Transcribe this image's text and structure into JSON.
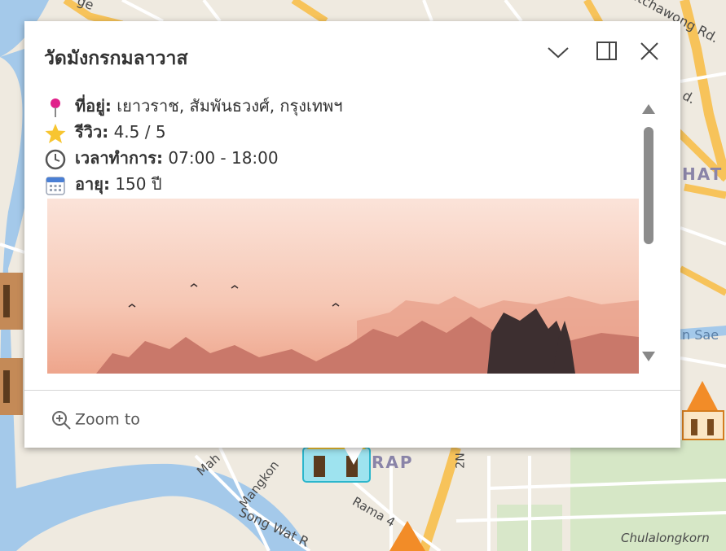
{
  "map": {
    "street_labels": [
      "ge",
      "Ratchawong Rd.",
      "d.",
      "HAT",
      "n Sae",
      "Mah",
      "Mangkon",
      "Song Wat R",
      "Rama 4",
      "RAP",
      "Chulalongkorn",
      "2N"
    ]
  },
  "popup": {
    "title": "วัดมังกรกมลาวาส",
    "fields": [
      {
        "icon": "pin-icon",
        "label": "ที่อยู่:",
        "value": "เยาวราช, สัมพันธวงศ์, กรุงเทพฯ"
      },
      {
        "icon": "star-icon",
        "label": "รีวิว:",
        "value": "4.5 / 5"
      },
      {
        "icon": "clock-icon",
        "label": "เวลาทำการ:",
        "value": "07:00 - 18:00"
      },
      {
        "icon": "calendar-icon",
        "label": "อายุ:",
        "value": "150 ปี"
      }
    ],
    "footer": {
      "zoom_label": "Zoom to"
    }
  },
  "colors": {
    "road_major": "#f7c35a",
    "water": "#a4c9ea",
    "park": "#cfe6bf"
  }
}
